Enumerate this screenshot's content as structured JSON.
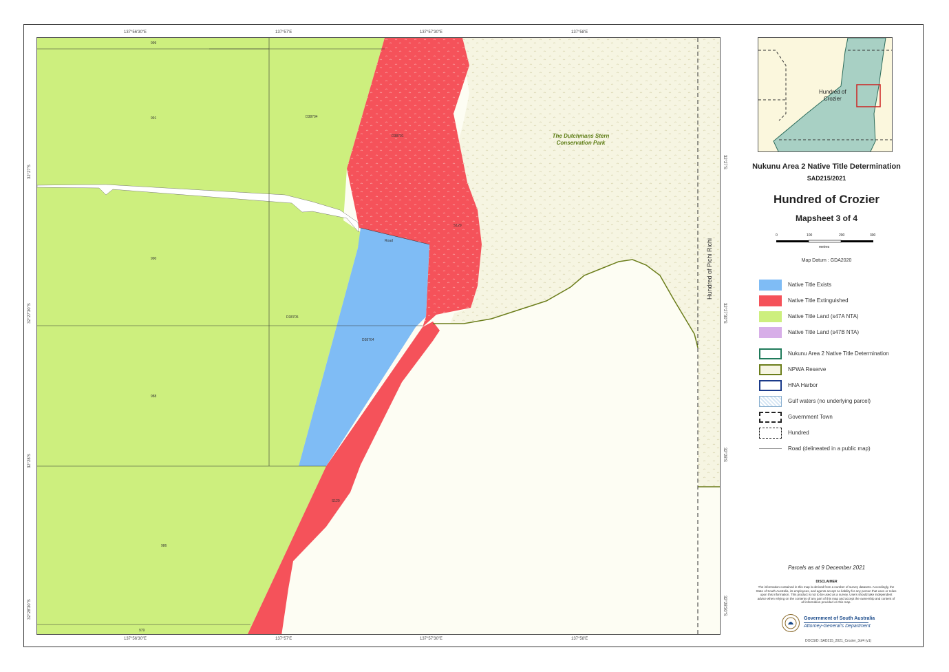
{
  "map": {
    "park_label": [
      "The Dutchmans Stern",
      "Conservation Park"
    ],
    "hundred_side_label": "Hundred of Pichi Richi",
    "parcel_labels": {
      "p1": "999",
      "p2": "991",
      "p3": "D38704",
      "p4": "D38701",
      "p5": "S129",
      "p6": "990",
      "p7": "Road",
      "p8": "D38705",
      "p9": "D38704",
      "p10": "988",
      "p11": "S120",
      "p12": "986",
      "p13": "979"
    },
    "top_ticks": [
      "137°56'30\"E",
      "137°57'E",
      "137°57'30\"E",
      "137°58'E"
    ],
    "bottom_ticks": [
      "137°56'30\"E",
      "137°57'E",
      "137°57'30\"E",
      "137°58'E"
    ],
    "left_ticks": [
      "32°27'S",
      "32°27'30\"S",
      "32°28'S",
      "32°28'30\"S"
    ],
    "right_ticks": [
      "32°27'S",
      "32°27'30\"S",
      "32°28'S",
      "32°28'30\"S"
    ],
    "colors": {
      "native_title_exists": "#7fbcf5",
      "native_title_extinguished": "#f5525a",
      "native_title_land_a": "#cdef7e",
      "native_title_land_b": "#d7aee8",
      "park_fill": "#f6f5e2",
      "water_fill": "#fdfdf3",
      "determination_border": "#1f7a5a",
      "reserve_border": "#6b7d1a"
    }
  },
  "inset": {
    "label": [
      "Hundred of",
      "Crozier"
    ]
  },
  "titles": {
    "determination": "Nukunu Area 2 Native Title Determination",
    "case_number": "SAD215/2021",
    "hundred": "Hundred of Crozier",
    "mapsheet": "Mapsheet 3 of 4"
  },
  "scale": {
    "ticks": [
      "0",
      "100",
      "200",
      "300"
    ],
    "unit": "metres"
  },
  "datum": "Map Datum : GDA2020",
  "legend": [
    {
      "label": "Native Title Exists",
      "swatch": "exists"
    },
    {
      "label": "Native Title Extinguished",
      "swatch": "extinguished"
    },
    {
      "label": "Native Title Land (s47A NTA)",
      "swatch": "land-a"
    },
    {
      "label": "Native Title Land (s47B NTA)",
      "swatch": "land-b"
    },
    {
      "label": "Nukunu Area 2 Native Title Determination",
      "swatch": "determination"
    },
    {
      "label": "NPWA Reserve",
      "swatch": "reserve"
    },
    {
      "label": "HNA Harbor",
      "swatch": "harbor"
    },
    {
      "label": "Gulf waters (no underlying parcel)",
      "swatch": "gulf"
    },
    {
      "label": "Government Town",
      "swatch": "town"
    },
    {
      "label": "Hundred",
      "swatch": "hundred"
    },
    {
      "label": "Road (delineated in a public map)",
      "swatch": "road"
    }
  ],
  "parcels_date": "Parcels as at 9 December 2021",
  "disclaimer": {
    "heading": "DISCLAIMER",
    "text": "The information contained in this map is derived from a number of survey datasets. Accordingly, the State of South Australia, its employees, and agents accept no liability for any person that uses or relies upon this information. This product is not to be used as a survey. Users should take independent advice when relying on the contents of any part of this map and accept the ownership and content of all information provided on this map."
  },
  "government": {
    "line1": "Government of South Australia",
    "line2": "Attorney-General's Department"
  },
  "footer_ref": "DOCSID: SAD215_2021_Crozier_3of4 (v1)"
}
